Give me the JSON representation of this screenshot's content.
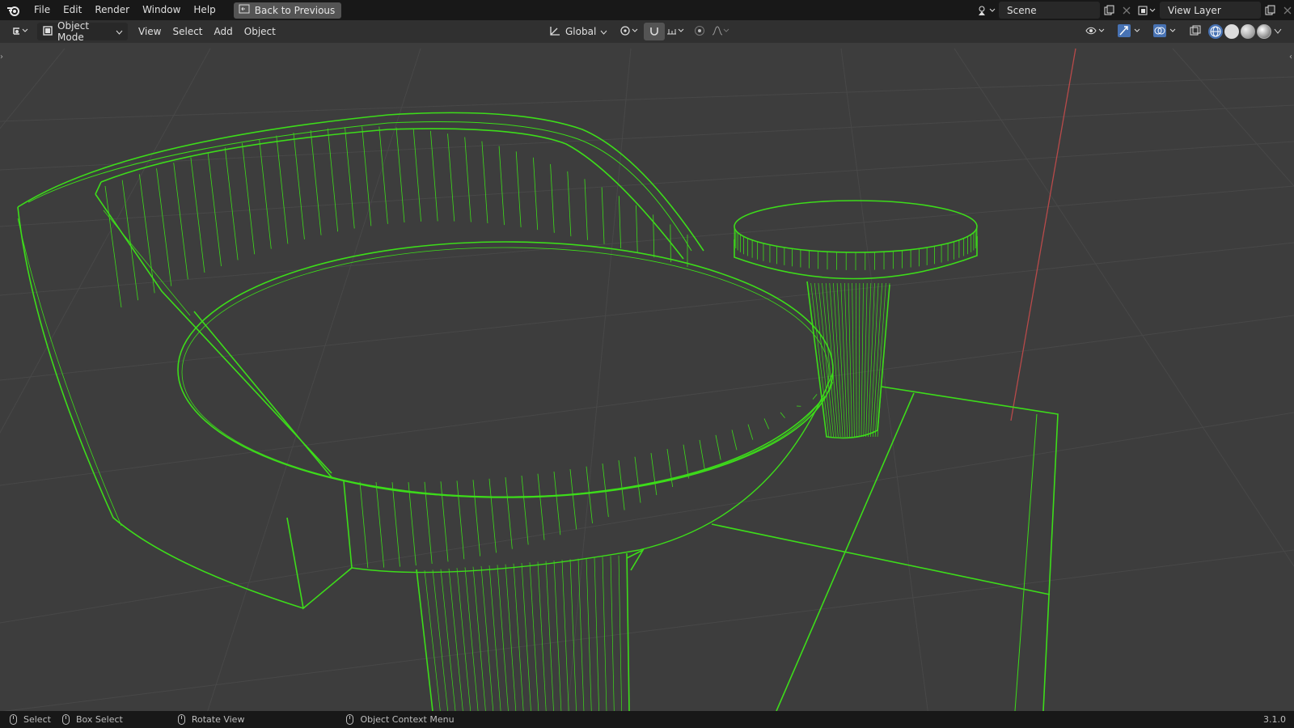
{
  "topbar": {
    "menus": [
      "File",
      "Edit",
      "Render",
      "Window",
      "Help"
    ],
    "back_button": "Back to Previous",
    "scene": {
      "value": "Scene"
    },
    "view_layer": {
      "value": "View Layer"
    }
  },
  "header": {
    "mode": "Object Mode",
    "menus": [
      "View",
      "Select",
      "Add",
      "Object"
    ],
    "transform_orientation": "Global"
  },
  "statusbar": {
    "select": "Select",
    "box_select": "Box Select",
    "rotate_view": "Rotate View",
    "context_menu": "Object Context Menu",
    "version": "3.1.0"
  },
  "colors": {
    "wire": "#3ddc1a",
    "grid": "#4a4a4a",
    "x_axis": "#b84a4a",
    "background": "#3d3d3d"
  },
  "icons": [
    "blender-logo-icon",
    "back-icon",
    "scene-icon",
    "copy-icon",
    "close-icon",
    "view-layer-icon",
    "editor-type-icon",
    "object-mode-icon",
    "orientation-icon",
    "pivot-icon",
    "snap-icon",
    "snap-target-icon",
    "proportional-icon",
    "falloff-icon",
    "visibility-icon",
    "gizmo-icon",
    "overlay-icon",
    "xray-icon",
    "wireframe-shading-icon",
    "solid-shading-icon",
    "material-shading-icon",
    "rendered-shading-icon",
    "mouse-left-icon",
    "mouse-drag-icon",
    "mouse-middle-icon",
    "mouse-right-icon"
  ]
}
